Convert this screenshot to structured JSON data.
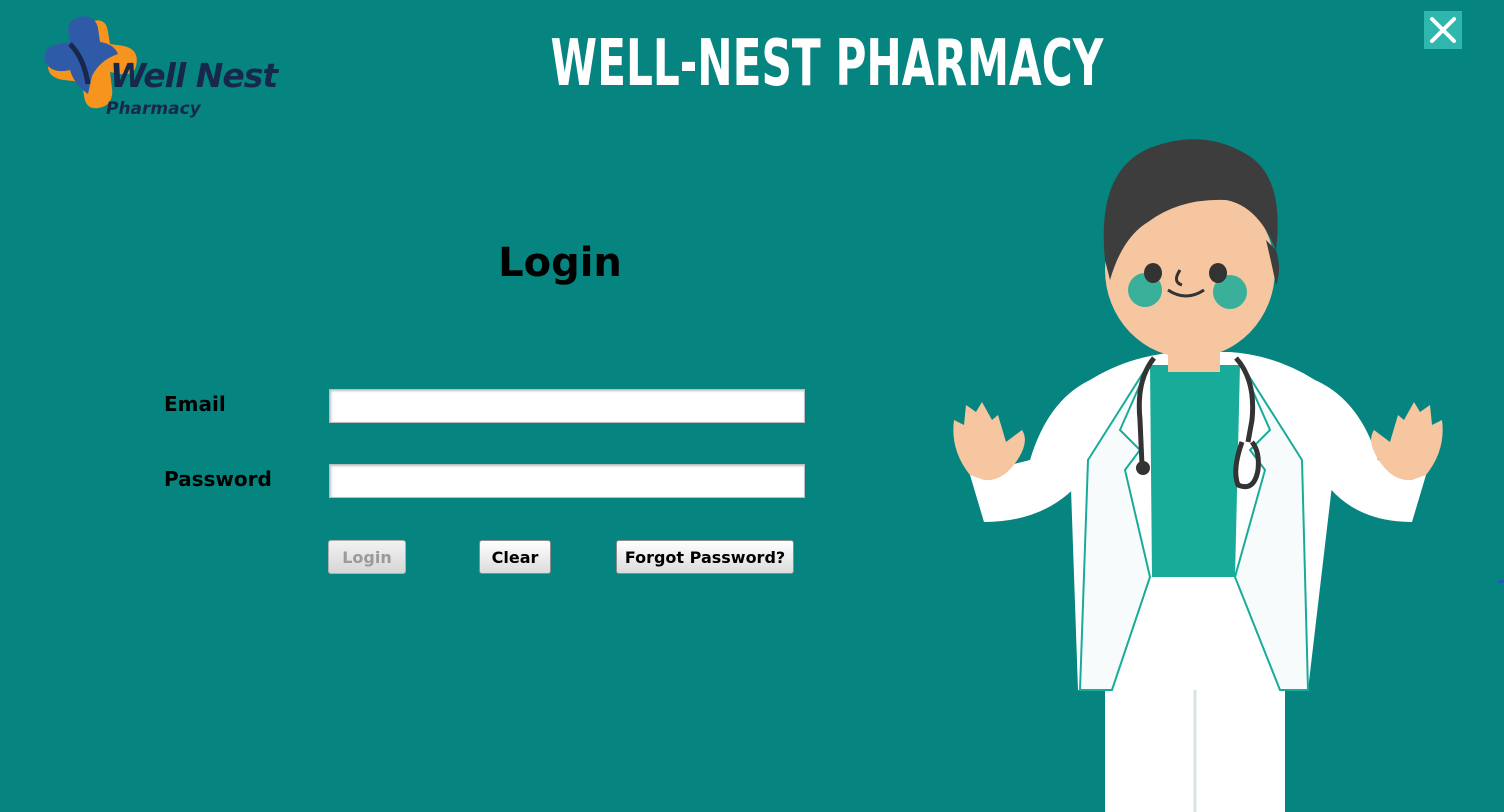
{
  "brand": {
    "logo_name": "Well Nest",
    "logo_sub": "Pharmacy",
    "title": "WELL-NEST PHARMACY",
    "colors": {
      "background": "#06847f",
      "logo_blue": "#2f5aa8",
      "logo_orange": "#f7941d",
      "logo_text": "#17284c",
      "close_button": "#2fb7ad"
    }
  },
  "window": {
    "close_icon": "close-x"
  },
  "login": {
    "heading": "Login",
    "email_label": "Email",
    "email_value": "",
    "password_label": "Password",
    "password_value": "",
    "buttons": {
      "login": "Login",
      "clear": "Clear",
      "forgot": "Forgot Password?"
    },
    "login_enabled": false
  },
  "illustration": {
    "subject": "doctor-illustration"
  }
}
